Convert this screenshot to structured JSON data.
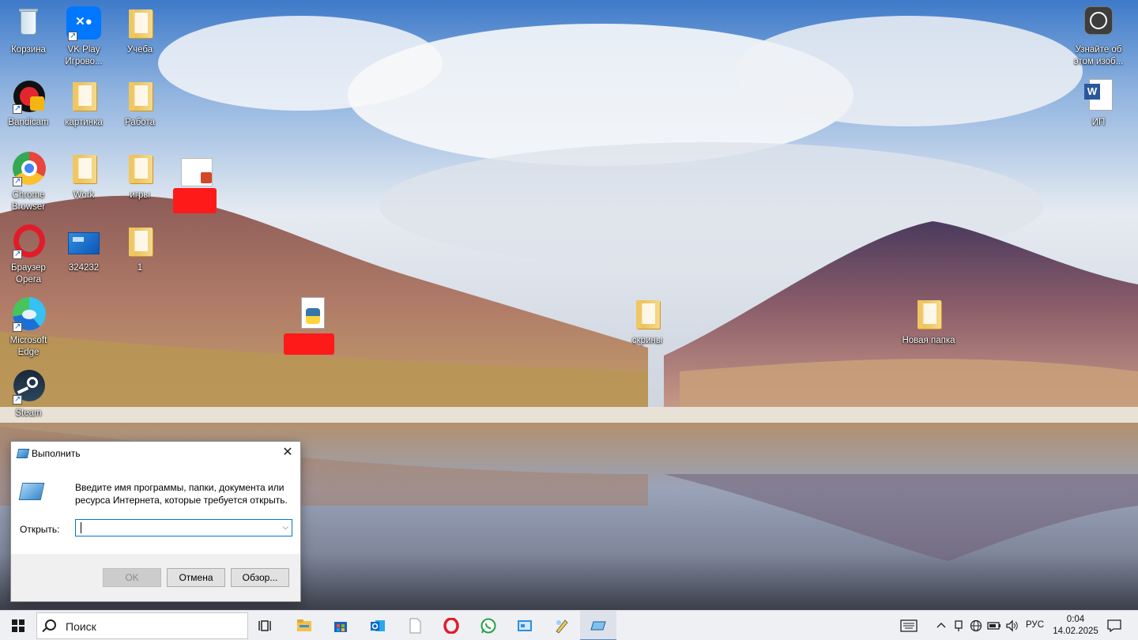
{
  "desktop": {
    "icons": [
      {
        "label": "Корзина",
        "icon": "recycle-bin-icon"
      },
      {
        "label": "VK Play Игрово...",
        "icon": "vk-play-icon"
      },
      {
        "label": "Учеба",
        "icon": "folder-icon"
      },
      {
        "label": "Bandicam",
        "icon": "bandicam-icon"
      },
      {
        "label": "картинка",
        "icon": "folder-icon"
      },
      {
        "label": "Работа",
        "icon": "folder-icon"
      },
      {
        "label": "Chrome Browser",
        "icon": "chrome-icon"
      },
      {
        "label": "Work",
        "icon": "folder-icon"
      },
      {
        "label": "игры",
        "icon": "folder-icon"
      },
      {
        "label": "",
        "icon": "powerpoint-file-icon"
      },
      {
        "label": "Браузер Opera",
        "icon": "opera-icon"
      },
      {
        "label": "324232",
        "icon": "image-file-icon"
      },
      {
        "label": "1",
        "icon": "folder-icon"
      },
      {
        "label": "Microsoft Edge",
        "icon": "edge-icon"
      },
      {
        "label": "",
        "icon": "python-file-icon"
      },
      {
        "label": "Steam",
        "icon": "steam-icon"
      },
      {
        "label": "скрины",
        "icon": "folder-icon"
      },
      {
        "label": "Новая папка",
        "icon": "folder-icon"
      },
      {
        "label": "Узнайте об этом изоб...",
        "icon": "learn-image-icon"
      },
      {
        "label": "ИП",
        "icon": "word-file-icon"
      }
    ]
  },
  "run_dialog": {
    "title": "Выполнить",
    "description": "Введите имя программы, папки, документа или ресурса Интернета, которые требуется открыть.",
    "open_label": "Открыть:",
    "input_value": "",
    "ok_label": "OK",
    "cancel_label": "Отмена",
    "browse_label": "Обзор..."
  },
  "taskbar": {
    "search_placeholder": "Поиск",
    "apps": [
      "task-view-icon",
      "file-explorer-icon",
      "store-icon",
      "outlook-icon",
      "notepad-icon",
      "opera-icon",
      "whatsapp-icon",
      "control-panel-icon",
      "paint-icon",
      "run-icon"
    ],
    "language": "РУС",
    "time": "0:04",
    "date": "14.02.2025"
  },
  "colors": {
    "accent": "#0078d7",
    "redaction": "#ff1a1a",
    "taskbar_bg": "#eef0f4"
  }
}
